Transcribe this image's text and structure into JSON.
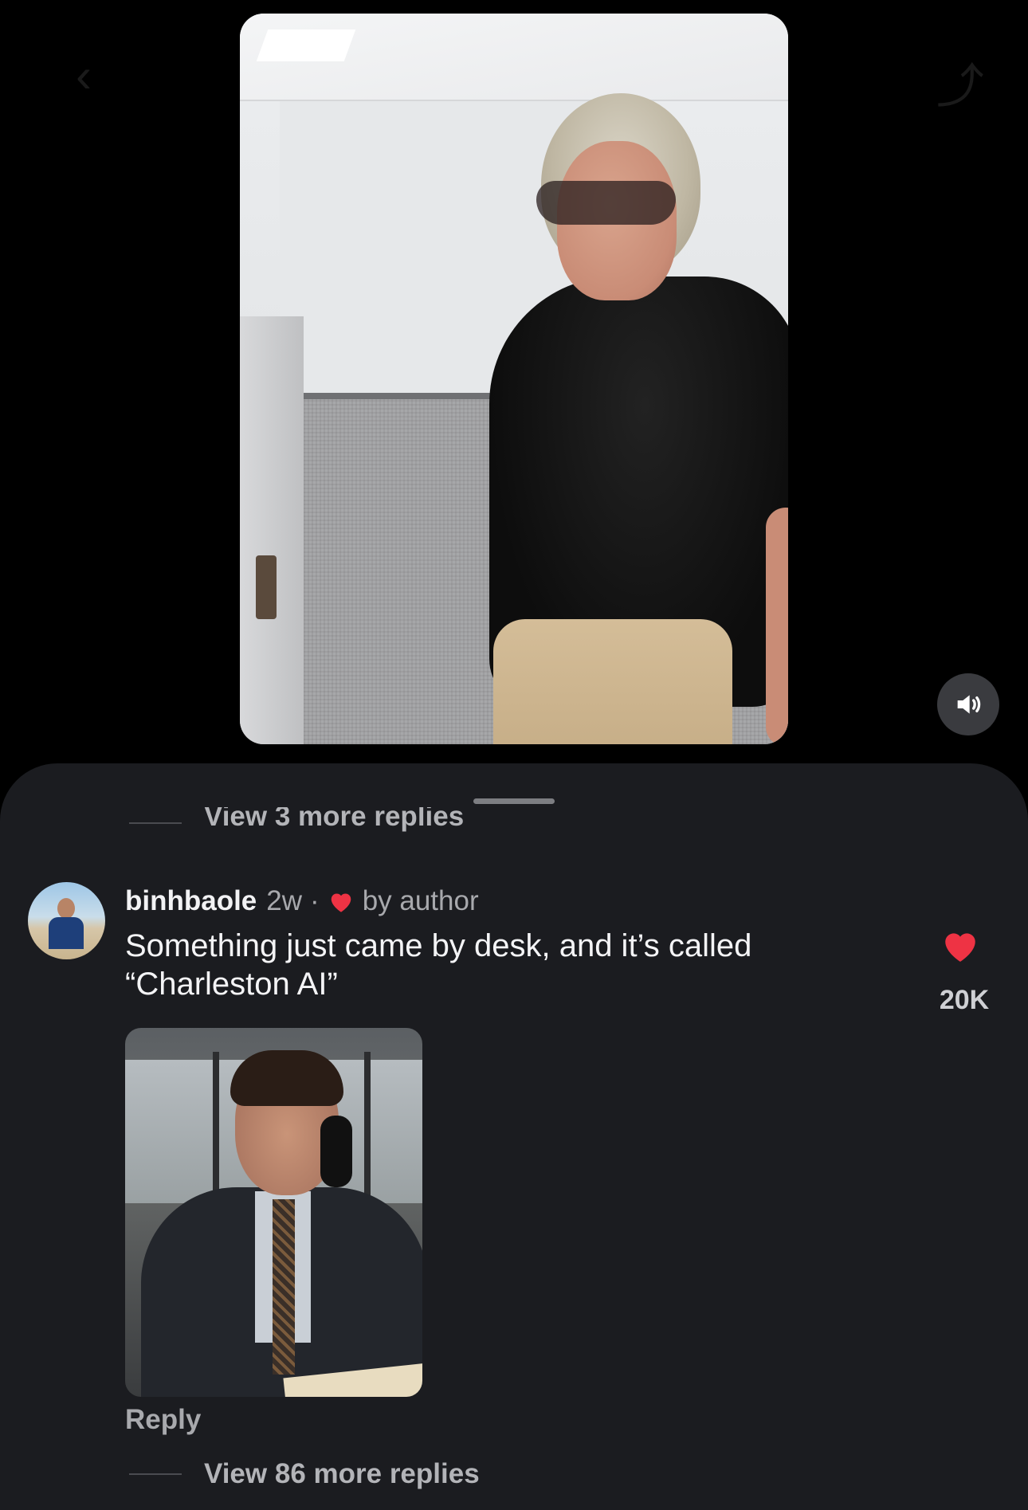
{
  "video": {
    "sound": "on"
  },
  "comments": {
    "top_replies_link": "View 3 more replies",
    "comment": {
      "username": "binhbaole",
      "time": "2w",
      "separator": "·",
      "liked_by_author_label": "by author",
      "text": "Something just came by desk, and it’s called “Charleston AI”",
      "like_count": "20K",
      "reply_label": "Reply",
      "more_replies_link": "View 86 more replies"
    }
  },
  "colors": {
    "background": "#000000",
    "sheet": "#1b1c20",
    "heart": "#ee3344",
    "muted_text": "#a8a9ad"
  },
  "icons": {
    "mute": "speaker-on-icon",
    "author_like": "heart-icon",
    "like": "heart-icon"
  }
}
